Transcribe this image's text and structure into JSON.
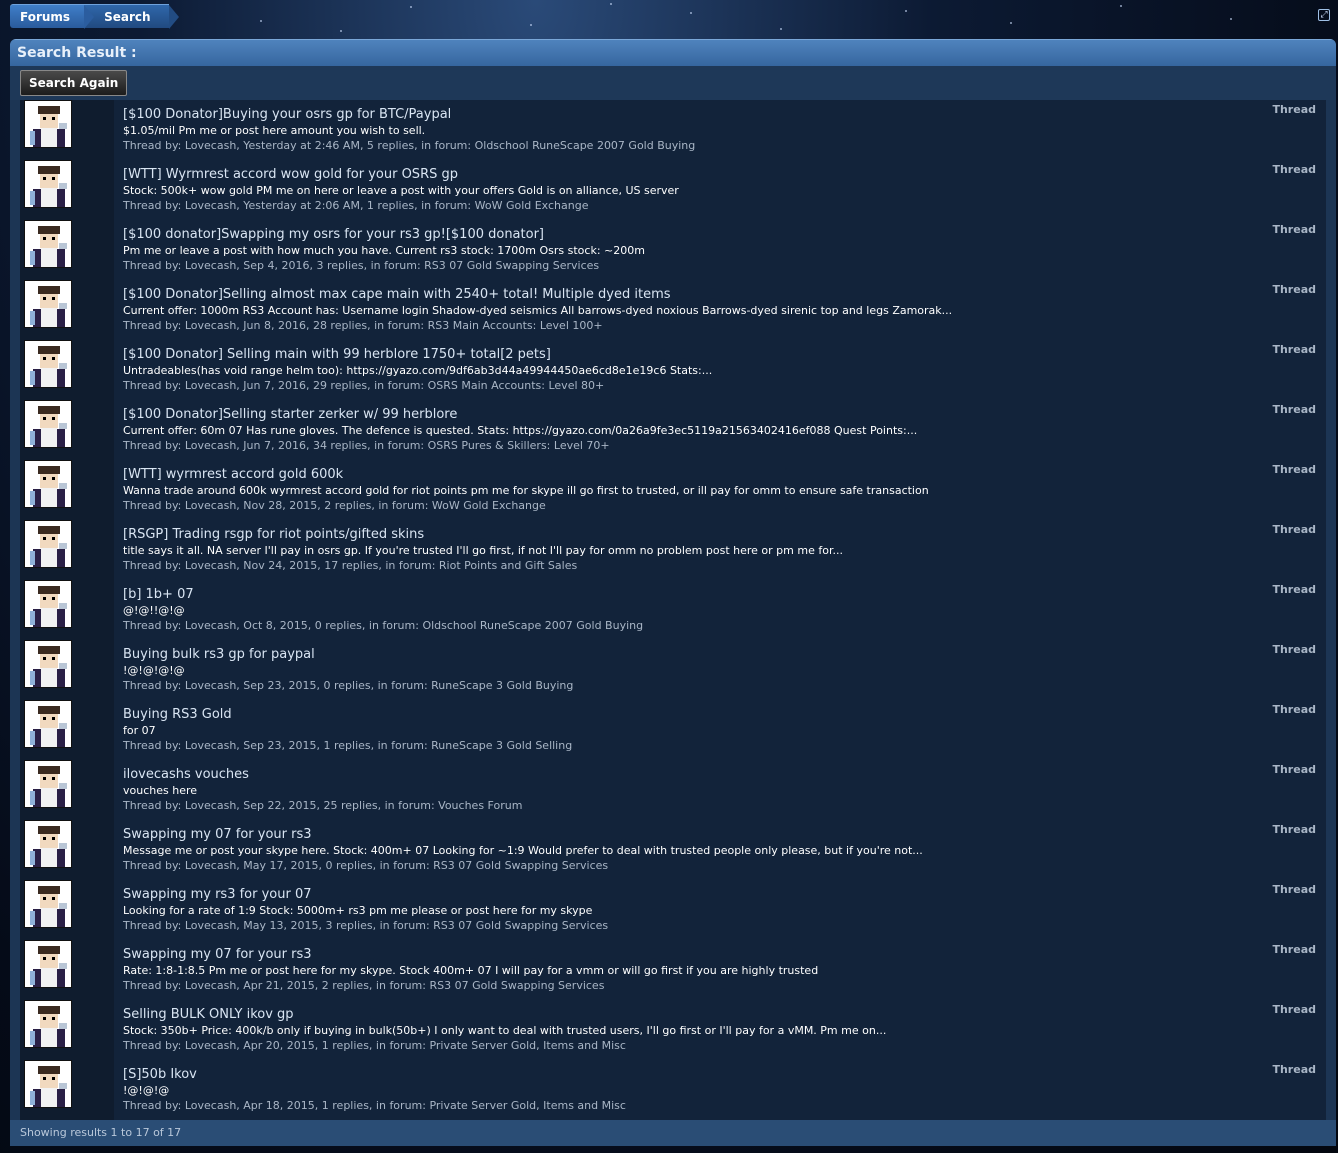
{
  "breadcrumb": {
    "forums": "Forums",
    "search": "Search"
  },
  "panel": {
    "title": "Search Result :",
    "search_again": "Search Again"
  },
  "results": [
    {
      "title": "[$100 Donator]Buying your osrs gp for BTC/Paypal",
      "snippet": "$1.05/mil Pm me or post here amount you wish to sell.",
      "meta": "Thread by: Lovecash, Yesterday at 2:46 AM, 5 replies, in forum: Oldschool RuneScape 2007 Gold Buying",
      "type": "Thread"
    },
    {
      "title": "[WTT] Wyrmrest accord wow gold for your OSRS gp",
      "snippet": "Stock: 500k+ wow gold PM me on here or leave a post with your offers Gold is on alliance, US server",
      "meta": "Thread by: Lovecash, Yesterday at 2:06 AM, 1 replies, in forum: WoW Gold Exchange",
      "type": "Thread"
    },
    {
      "title": "[$100 donator]Swapping my osrs for your rs3 gp![$100 donator]",
      "snippet": "Pm me or leave a post with how much you have. Current rs3 stock: 1700m Osrs stock: ~200m",
      "meta": "Thread by: Lovecash, Sep 4, 2016, 3 replies, in forum: RS3 07 Gold Swapping Services",
      "type": "Thread"
    },
    {
      "title": "[$100 Donator]Selling almost max cape main with 2540+ total! Multiple dyed items",
      "snippet": "Current offer: 1000m RS3 Account has: Username login Shadow-dyed seismics All barrows-dyed noxious Barrows-dyed sirenic top and legs Zamorak...",
      "meta": "Thread by: Lovecash, Jun 8, 2016, 28 replies, in forum: RS3 Main Accounts: Level 100+",
      "type": "Thread"
    },
    {
      "title": "[$100 Donator] Selling main with 99 herblore 1750+ total[2 pets]",
      "snippet": "Untradeables(has void range helm too): https://gyazo.com/9df6ab3d44a49944450ae6cd8e1e19c6 Stats:...",
      "meta": "Thread by: Lovecash, Jun 7, 2016, 29 replies, in forum: OSRS Main Accounts: Level 80+",
      "type": "Thread"
    },
    {
      "title": "[$100 Donator]Selling starter zerker w/ 99 herblore",
      "snippet": "Current offer: 60m 07 Has rune gloves. The defence is quested. Stats: https://gyazo.com/0a26a9fe3ec5119a21563402416ef088 Quest Points:...",
      "meta": "Thread by: Lovecash, Jun 7, 2016, 34 replies, in forum: OSRS Pures & Skillers: Level 70+",
      "type": "Thread"
    },
    {
      "title": "[WTT] wyrmrest accord gold 600k",
      "snippet": "Wanna trade around 600k wyrmrest accord gold for riot points pm me for skype ill go first to trusted, or ill pay for omm to ensure safe transaction",
      "meta": "Thread by: Lovecash, Nov 28, 2015, 2 replies, in forum: WoW Gold Exchange",
      "type": "Thread"
    },
    {
      "title": "[RSGP] Trading rsgp for riot points/gifted skins",
      "snippet": "title says it all. NA server I'll pay in osrs gp. If you're trusted I'll go first, if not I'll pay for omm no problem post here or pm me for...",
      "meta": "Thread by: Lovecash, Nov 24, 2015, 17 replies, in forum: Riot Points and Gift Sales",
      "type": "Thread"
    },
    {
      "title": "[b] 1b+ 07",
      "snippet": "@!@!!@!@",
      "meta": "Thread by: Lovecash, Oct 8, 2015, 0 replies, in forum: Oldschool RuneScape 2007 Gold Buying",
      "type": "Thread"
    },
    {
      "title": "Buying bulk rs3 gp for paypal",
      "snippet": "!@!@!@!@",
      "meta": "Thread by: Lovecash, Sep 23, 2015, 0 replies, in forum: RuneScape 3 Gold Buying",
      "type": "Thread"
    },
    {
      "title": "Buying RS3 Gold",
      "snippet": "for 07",
      "meta": "Thread by: Lovecash, Sep 23, 2015, 1 replies, in forum: RuneScape 3 Gold Selling",
      "type": "Thread"
    },
    {
      "title": "ilovecashs vouches",
      "snippet": "vouches here",
      "meta": "Thread by: Lovecash, Sep 22, 2015, 25 replies, in forum: Vouches Forum",
      "type": "Thread"
    },
    {
      "title": "Swapping my 07 for your rs3",
      "snippet": "Message me or post your skype here. Stock: 400m+ 07 Looking for ~1:9 Would prefer to deal with trusted people only please, but if you're not...",
      "meta": "Thread by: Lovecash, May 17, 2015, 0 replies, in forum: RS3 07 Gold Swapping Services",
      "type": "Thread"
    },
    {
      "title": "Swapping my rs3 for your 07",
      "snippet": "Looking for a rate of 1:9 Stock: 5000m+ rs3 pm me please or post here for my skype",
      "meta": "Thread by: Lovecash, May 13, 2015, 3 replies, in forum: RS3 07 Gold Swapping Services",
      "type": "Thread"
    },
    {
      "title": "Swapping my 07 for your rs3",
      "snippet": "Rate: 1:8-1:8.5 Pm me or post here for my skype. Stock 400m+ 07 I will pay for a vmm or will go first if you are highly trusted",
      "meta": "Thread by: Lovecash, Apr 21, 2015, 2 replies, in forum: RS3 07 Gold Swapping Services",
      "type": "Thread"
    },
    {
      "title": "Selling BULK ONLY ikov gp",
      "snippet": "Stock: 350b+ Price: 400k/b only if buying in bulk(50b+) I only want to deal with trusted users, I'll go first or I'll pay for a vMM. Pm me on...",
      "meta": "Thread by: Lovecash, Apr 20, 2015, 1 replies, in forum: Private Server Gold, Items and Misc",
      "type": "Thread"
    },
    {
      "title": "[S]50b Ikov",
      "snippet": "!@!@!@",
      "meta": "Thread by: Lovecash, Apr 18, 2015, 1 replies, in forum: Private Server Gold, Items and Misc",
      "type": "Thread"
    }
  ],
  "footer": {
    "text": "Showing results 1 to 17 of 17"
  }
}
